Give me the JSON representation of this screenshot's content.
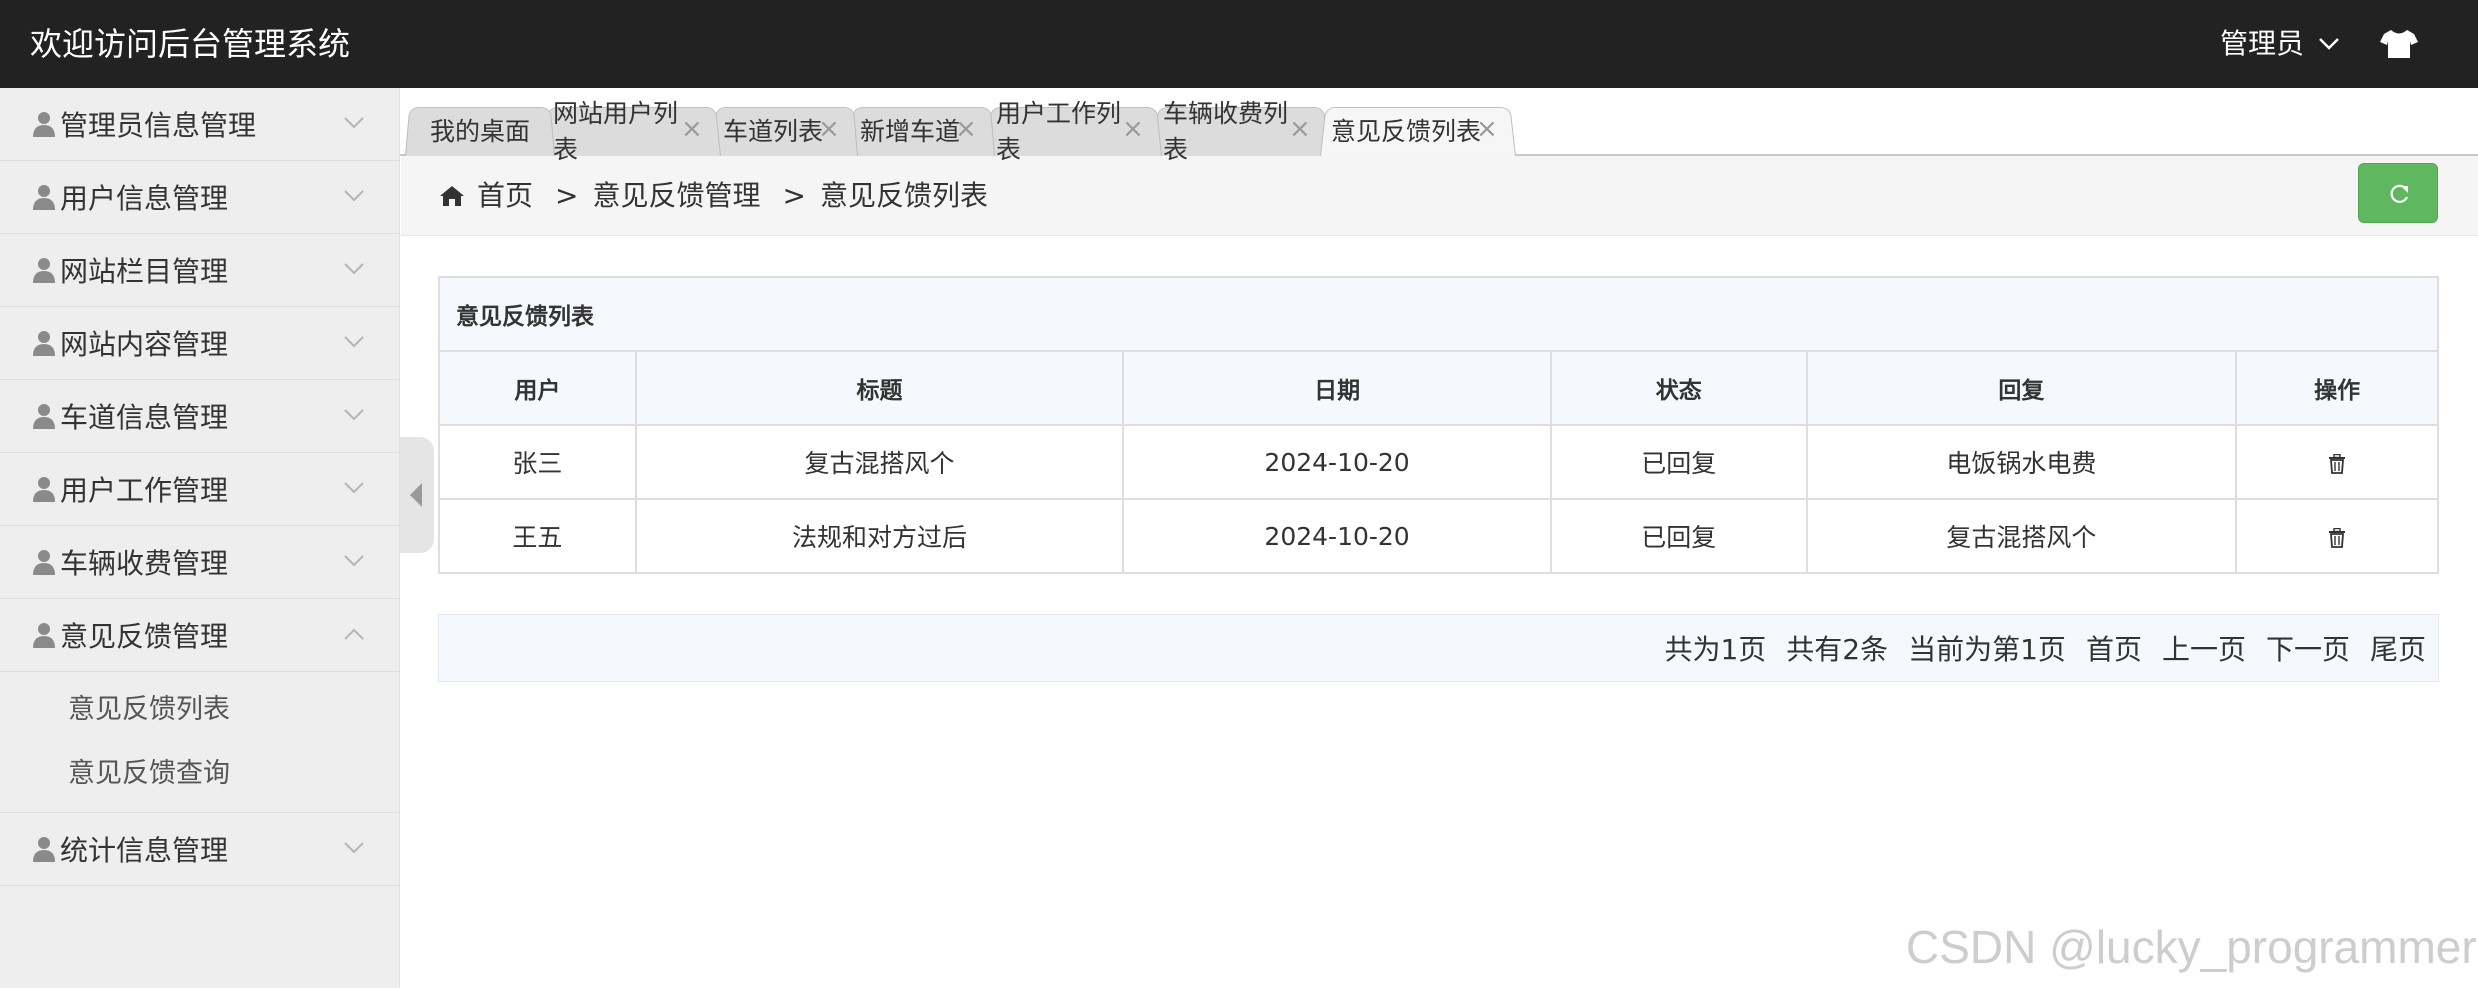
{
  "header": {
    "title": "欢迎访问后台管理系统",
    "user_label": "管理员",
    "user_chevron": "chevron-down-icon",
    "theme_icon": "tshirt-icon"
  },
  "sidebar": {
    "menus": [
      {
        "label": "管理员信息管理",
        "expanded": false
      },
      {
        "label": "用户信息管理",
        "expanded": false
      },
      {
        "label": "网站栏目管理",
        "expanded": false
      },
      {
        "label": "网站内容管理",
        "expanded": false
      },
      {
        "label": "车道信息管理",
        "expanded": false
      },
      {
        "label": "用户工作管理",
        "expanded": false
      },
      {
        "label": "车辆收费管理",
        "expanded": false
      },
      {
        "label": "意见反馈管理",
        "expanded": true
      },
      {
        "label": "统计信息管理",
        "expanded": false
      }
    ],
    "submenu": [
      "意见反馈列表",
      "意见反馈查询"
    ]
  },
  "tabs": [
    {
      "label": "我的桌面",
      "closable": false,
      "active": false
    },
    {
      "label": "网站用户列表",
      "closable": true,
      "active": false
    },
    {
      "label": "车道列表",
      "closable": true,
      "active": false
    },
    {
      "label": "新增车道",
      "closable": true,
      "active": false
    },
    {
      "label": "用户工作列表",
      "closable": true,
      "active": false
    },
    {
      "label": "车辆收费列表",
      "closable": true,
      "active": false
    },
    {
      "label": "意见反馈列表",
      "closable": true,
      "active": true
    }
  ],
  "tab_close_glyph": "×",
  "breadcrumb": {
    "home": "首页",
    "level1": "意见反馈管理",
    "level2": "意见反馈列表",
    "separator": ">"
  },
  "table": {
    "caption": "意见反馈列表",
    "columns": [
      "用户",
      "标题",
      "日期",
      "状态",
      "回复",
      "操作"
    ],
    "rows": [
      {
        "user": "张三",
        "title": "复古混搭风个",
        "date": "2024-10-20",
        "status": "已回复",
        "reply": "电饭锅水电费",
        "action_icon": "trash-icon"
      },
      {
        "user": "王五",
        "title": "法规和对方过后",
        "date": "2024-10-20",
        "status": "已回复",
        "reply": "复古混搭风个",
        "action_icon": "trash-icon"
      }
    ]
  },
  "pagination": {
    "total_pages": "共为1页",
    "total_items": "共有2条",
    "current": "当前为第1页",
    "first": "首页",
    "prev": "上一页",
    "next": "下一页",
    "last": "尾页"
  },
  "watermark": "CSDN @lucky_programmer",
  "colors": {
    "header_bg": "#222222",
    "sidebar_bg": "#eeeeee",
    "refresh_button": "#5fb760",
    "table_header_bg": "#f5f8fc"
  }
}
